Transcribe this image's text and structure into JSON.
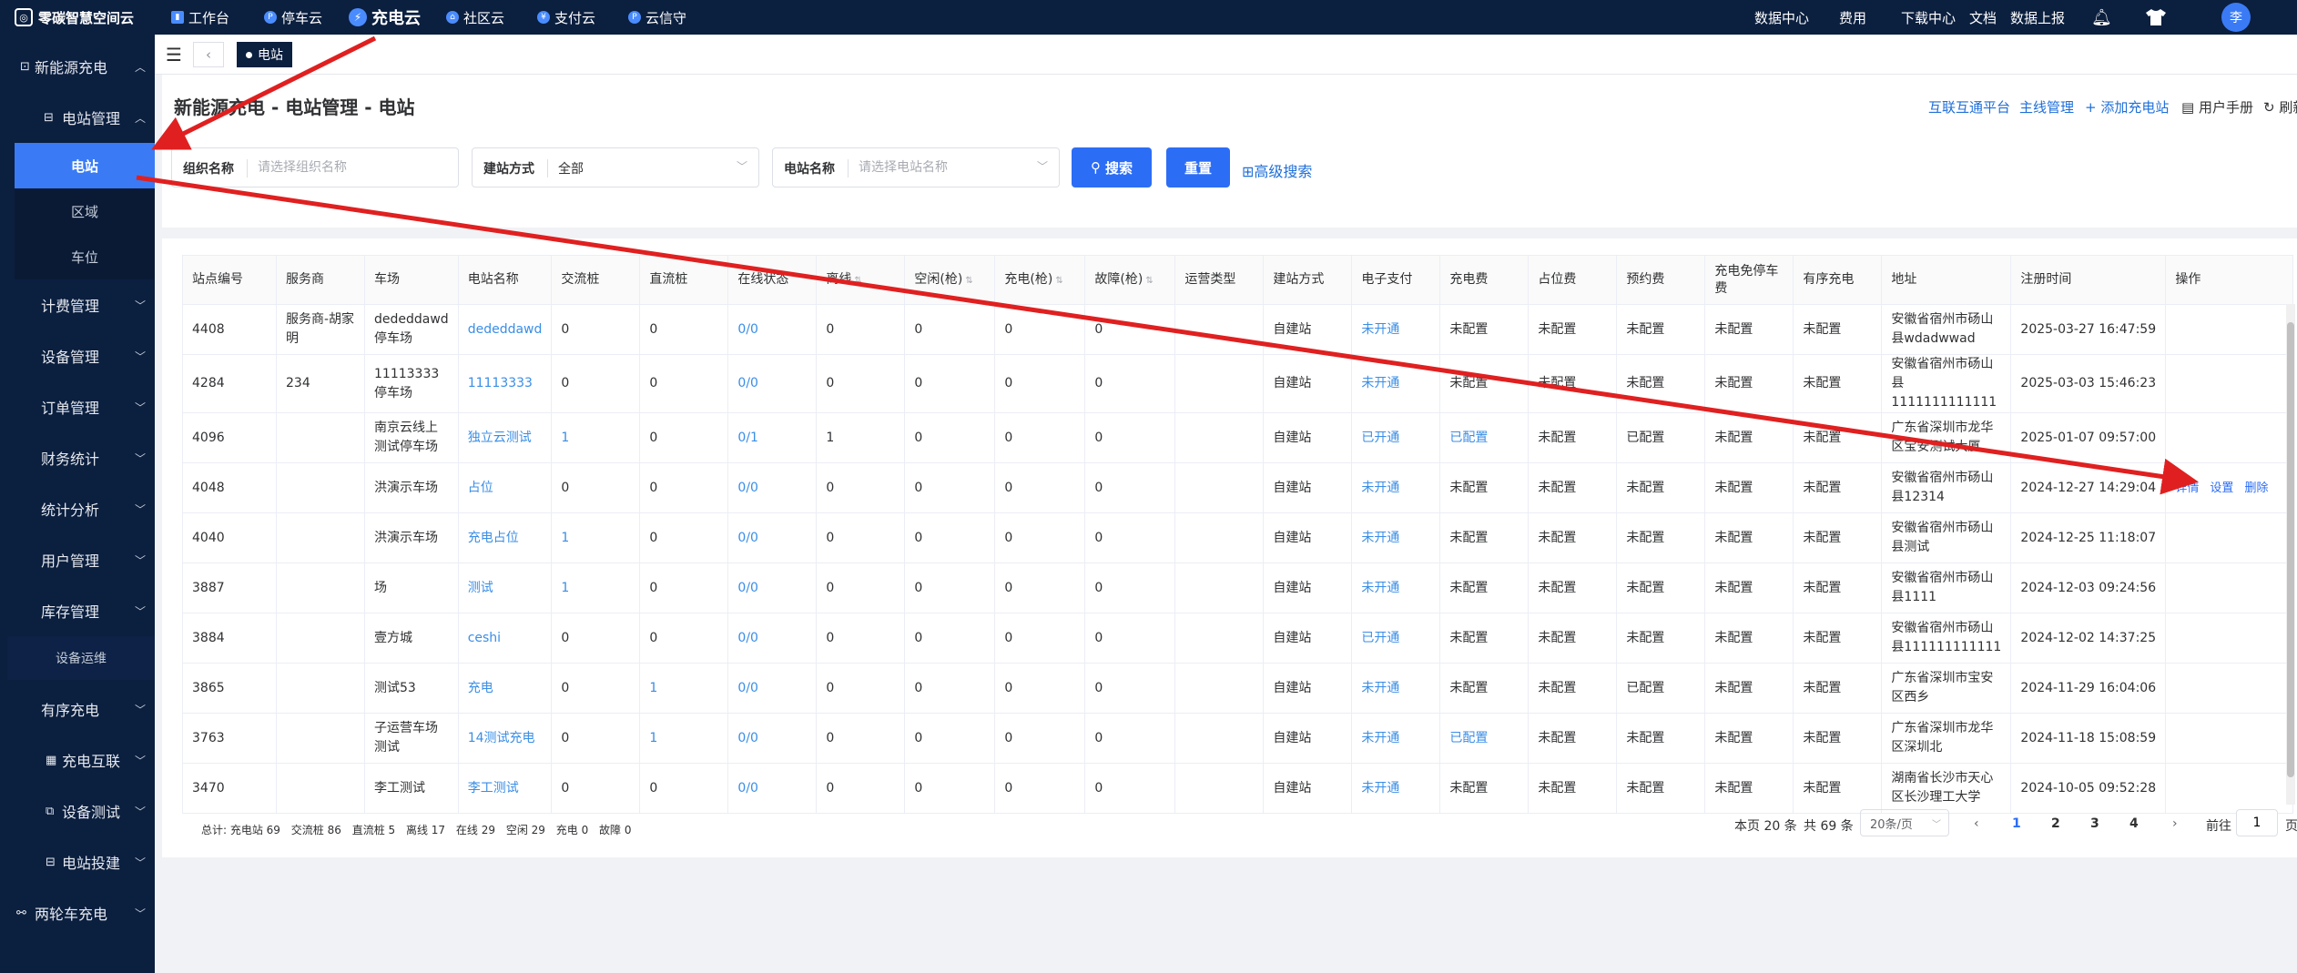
{
  "topbar": {
    "brand": "零碳智慧空间云",
    "nav": [
      {
        "label": "工作台",
        "icon": "chart-icon"
      },
      {
        "label": "停车云",
        "icon": "parking-icon"
      },
      {
        "label": "充电云",
        "icon": "charging-icon",
        "active": true
      },
      {
        "label": "社区云",
        "icon": "community-icon"
      },
      {
        "label": "支付云",
        "icon": "payment-icon"
      },
      {
        "label": "云信守",
        "icon": "cloud-guard-icon"
      }
    ],
    "right": [
      "数据中心",
      "费用",
      "下载中心",
      "文档",
      "数据上报"
    ],
    "avatar": "李"
  },
  "sidebar": {
    "sections": [
      {
        "label": "新能源充电",
        "expanded": true
      },
      {
        "label": "电站管理",
        "expanded": true
      },
      {
        "label": "计费管理"
      },
      {
        "label": "设备管理"
      },
      {
        "label": "订单管理"
      },
      {
        "label": "财务统计"
      },
      {
        "label": "统计分析"
      },
      {
        "label": "用户管理"
      },
      {
        "label": "库存管理"
      },
      {
        "label": "有序充电"
      },
      {
        "label": "充电互联"
      },
      {
        "label": "设备测试"
      },
      {
        "label": "电站投建"
      },
      {
        "label": "两轮车充电"
      }
    ],
    "sub_items": [
      "电站",
      "区域",
      "车位"
    ],
    "ops_item": "设备运维"
  },
  "tabs": {
    "active": "电站"
  },
  "page": {
    "title": "新能源充电 - 电站管理 - 电站",
    "links": [
      "互联互通平台",
      "主线管理",
      "+ 添加充电站",
      "用户手册",
      "刷新"
    ]
  },
  "filters": {
    "org_label": "组织名称",
    "org_placeholder": "请选择组织名称",
    "build_label": "建站方式",
    "build_value": "全部",
    "station_label": "电站名称",
    "station_placeholder": "请选择电站名称",
    "search": "搜索",
    "reset": "重置",
    "advanced": "高级搜索"
  },
  "table": {
    "columns": [
      "站点编号",
      "服务商",
      "车场",
      "电站名称",
      "交流桩",
      "直流桩",
      "在线状态",
      "离线",
      "空闲(枪)",
      "充电(枪)",
      "故障(枪)",
      "运营类型",
      "建站方式",
      "电子支付",
      "充电费",
      "占位费",
      "预约费",
      "充电免停车费",
      "有序充电",
      "地址",
      "注册时间",
      "操作"
    ],
    "rows": [
      [
        "4408",
        "服务商-胡家明",
        "dededdawd停车场",
        "dededdawd",
        "0",
        "0",
        "0/0",
        "0",
        "0",
        "0",
        "0",
        "",
        "自建站",
        "未开通",
        "未配置",
        "未配置",
        "未配置",
        "未配置",
        "未配置",
        "安徽省宿州市砀山县wdadwwad",
        "2025-03-27 16:47:59"
      ],
      [
        "4284",
        "234",
        "11113333停车场",
        "11113333",
        "0",
        "0",
        "0/0",
        "0",
        "0",
        "0",
        "0",
        "",
        "自建站",
        "未开通",
        "未配置",
        "未配置",
        "未配置",
        "未配置",
        "未配置",
        "安徽省宿州市砀山县1111111111111",
        "2025-03-03 15:46:23"
      ],
      [
        "4096",
        "",
        "南京云线上测试停车场",
        "独立云测试",
        "1",
        "0",
        "0/1",
        "1",
        "0",
        "0",
        "0",
        "",
        "自建站",
        "已开通",
        "已配置",
        "未配置",
        "已配置",
        "未配置",
        "未配置",
        "广东省深圳市龙华区宝安测试大厦",
        "2025-01-07 09:57:00"
      ],
      [
        "4048",
        "",
        "洪演示车场",
        "占位",
        "0",
        "0",
        "0/0",
        "0",
        "0",
        "0",
        "0",
        "",
        "自建站",
        "未开通",
        "未配置",
        "未配置",
        "未配置",
        "未配置",
        "未配置",
        "安徽省宿州市砀山县12314",
        "2024-12-27 14:29:04"
      ],
      [
        "4040",
        "",
        "洪演示车场",
        "充电占位",
        "1",
        "0",
        "0/0",
        "0",
        "0",
        "0",
        "0",
        "",
        "自建站",
        "未开通",
        "未配置",
        "未配置",
        "未配置",
        "未配置",
        "未配置",
        "安徽省宿州市砀山县测试",
        "2024-12-25 11:18:07"
      ],
      [
        "3887",
        "",
        "场",
        "测试",
        "1",
        "0",
        "0/0",
        "0",
        "0",
        "0",
        "0",
        "",
        "自建站",
        "未开通",
        "未配置",
        "未配置",
        "未配置",
        "未配置",
        "未配置",
        "安徽省宿州市砀山县1111",
        "2024-12-03 09:24:56"
      ],
      [
        "3884",
        "",
        "壹方城",
        "ceshi",
        "0",
        "0",
        "0/0",
        "0",
        "0",
        "0",
        "0",
        "",
        "自建站",
        "已开通",
        "未配置",
        "未配置",
        "未配置",
        "未配置",
        "未配置",
        "安徽省宿州市砀山县111111111111",
        "2024-12-02 14:37:25"
      ],
      [
        "3865",
        "",
        "测试53",
        "充电",
        "0",
        "1",
        "0/0",
        "0",
        "0",
        "0",
        "0",
        "",
        "自建站",
        "未开通",
        "未配置",
        "未配置",
        "已配置",
        "未配置",
        "未配置",
        "广东省深圳市宝安区西乡",
        "2024-11-29 16:04:06"
      ],
      [
        "3763",
        "",
        "子运营车场测试",
        "14测试充电",
        "0",
        "1",
        "0/0",
        "0",
        "0",
        "0",
        "0",
        "",
        "自建站",
        "未开通",
        "已配置",
        "未配置",
        "未配置",
        "未配置",
        "未配置",
        "广东省深圳市龙华区深圳北",
        "2024-11-18 15:08:59"
      ],
      [
        "3470",
        "",
        "李工测试",
        "李工测试",
        "0",
        "0",
        "0/0",
        "0",
        "0",
        "0",
        "0",
        "",
        "自建站",
        "未开通",
        "未配置",
        "未配置",
        "未配置",
        "未配置",
        "未配置",
        "湖南省长沙市天心区长沙理工大学",
        "2024-10-05 09:52:28"
      ]
    ],
    "row4_actions": [
      "详情",
      "设置",
      "删除"
    ]
  },
  "summary": [
    "总计: 充电站 69",
    "交流桩 86",
    "直流桩 5",
    "离线 17",
    "在线 29",
    "空闲 29",
    "充电 0",
    "故障 0"
  ],
  "pagination": {
    "this_page": "本页 20 条",
    "total": "共 69 条",
    "page_size": "20条/页",
    "pages": [
      "1",
      "2",
      "3",
      "4"
    ],
    "goto_label": "前往",
    "goto_value": "1",
    "unit": "页"
  },
  "colors": {
    "accent": "#2c6df5",
    "nav_bg": "#0b1f3f",
    "link": "#3a8ee6",
    "arrow": "#e02020"
  }
}
